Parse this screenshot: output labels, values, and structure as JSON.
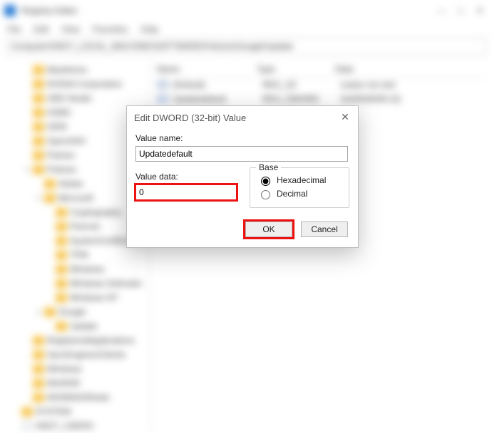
{
  "window": {
    "title": "Registry Editor",
    "menus": [
      "File",
      "Edit",
      "View",
      "Favorites",
      "Help"
    ],
    "path": "Computer\\HKEY_LOCAL_MACHINE\\SOFTWARE\\Policies\\Google\\Update",
    "win_min": "—",
    "win_max": "□",
    "win_close": "✕"
  },
  "tree": [
    {
      "d": 1,
      "exp": " ",
      "ico": "Y",
      "lbl": "Maxtheme"
    },
    {
      "d": 1,
      "exp": " ",
      "ico": "Y",
      "lbl": "NVIDIA Corporation"
    },
    {
      "d": 1,
      "exp": " ",
      "ico": "Y",
      "lbl": "OBS Studio"
    },
    {
      "d": 1,
      "exp": " ",
      "ico": "Y",
      "lbl": "ODBC"
    },
    {
      "d": 1,
      "exp": " ",
      "ico": "Y",
      "lbl": "OEM"
    },
    {
      "d": 1,
      "exp": " ",
      "ico": "Y",
      "lbl": "OpenSSH"
    },
    {
      "d": 1,
      "exp": " ",
      "ico": "Y",
      "lbl": "Partner"
    },
    {
      "d": 1,
      "exp": "v",
      "ico": "Y",
      "lbl": "Policies"
    },
    {
      "d": 2,
      "exp": " ",
      "ico": "Y",
      "lbl": "Adobe"
    },
    {
      "d": 2,
      "exp": "v",
      "ico": "Y",
      "lbl": "Microsoft"
    },
    {
      "d": 3,
      "exp": " ",
      "ico": "Y",
      "lbl": "Cryptography"
    },
    {
      "d": 3,
      "exp": " ",
      "ico": "Y",
      "lbl": "Peernet"
    },
    {
      "d": 3,
      "exp": " ",
      "ico": "Y",
      "lbl": "SystemCertificates"
    },
    {
      "d": 3,
      "exp": " ",
      "ico": "Y",
      "lbl": "TPM"
    },
    {
      "d": 3,
      "exp": " ",
      "ico": "Y",
      "lbl": "Windows"
    },
    {
      "d": 3,
      "exp": " ",
      "ico": "Y",
      "lbl": "Windows Defender"
    },
    {
      "d": 3,
      "exp": " ",
      "ico": "Y",
      "lbl": "Windows NT"
    },
    {
      "d": 2,
      "exp": "v",
      "ico": "Y",
      "lbl": "Google"
    },
    {
      "d": 3,
      "exp": " ",
      "ico": "Y",
      "lbl": "Update"
    },
    {
      "d": 1,
      "exp": " ",
      "ico": "Y",
      "lbl": "RegisteredApplications"
    },
    {
      "d": 1,
      "exp": " ",
      "ico": "Y",
      "lbl": "SyncEngines\\Clients"
    },
    {
      "d": 1,
      "exp": " ",
      "ico": "Y",
      "lbl": "Windows"
    },
    {
      "d": 1,
      "exp": " ",
      "ico": "Y",
      "lbl": "WinRAR"
    },
    {
      "d": 1,
      "exp": " ",
      "ico": "Y",
      "lbl": "WOW6432Node"
    },
    {
      "d": 0,
      "exp": " ",
      "ico": "Y",
      "lbl": "SYSTEM"
    },
    {
      "d": 0,
      "exp": " ",
      "ico": "B",
      "lbl": "HKEY_USERS"
    }
  ],
  "list": {
    "headers": [
      "Name",
      "Type",
      "Data"
    ],
    "rows": [
      {
        "ico": "reg",
        "n": "(Default)",
        "t": "REG_SZ",
        "d": "(value not set)"
      },
      {
        "ico": "dw",
        "n": "Updatedefault",
        "t": "REG_DWORD",
        "d": "0x00000000 (0)"
      }
    ]
  },
  "dialog": {
    "title": "Edit DWORD (32-bit) Value",
    "value_name_lbl": "Value name:",
    "value_name": "Updatedefault",
    "value_data_lbl": "Value data:",
    "value_data": "0",
    "base_lbl": "Base",
    "radio_hex": "Hexadecimal",
    "radio_dec": "Decimal",
    "ok": "OK",
    "cancel": "Cancel"
  },
  "highlights": {
    "value_data": true,
    "ok_btn": true
  }
}
